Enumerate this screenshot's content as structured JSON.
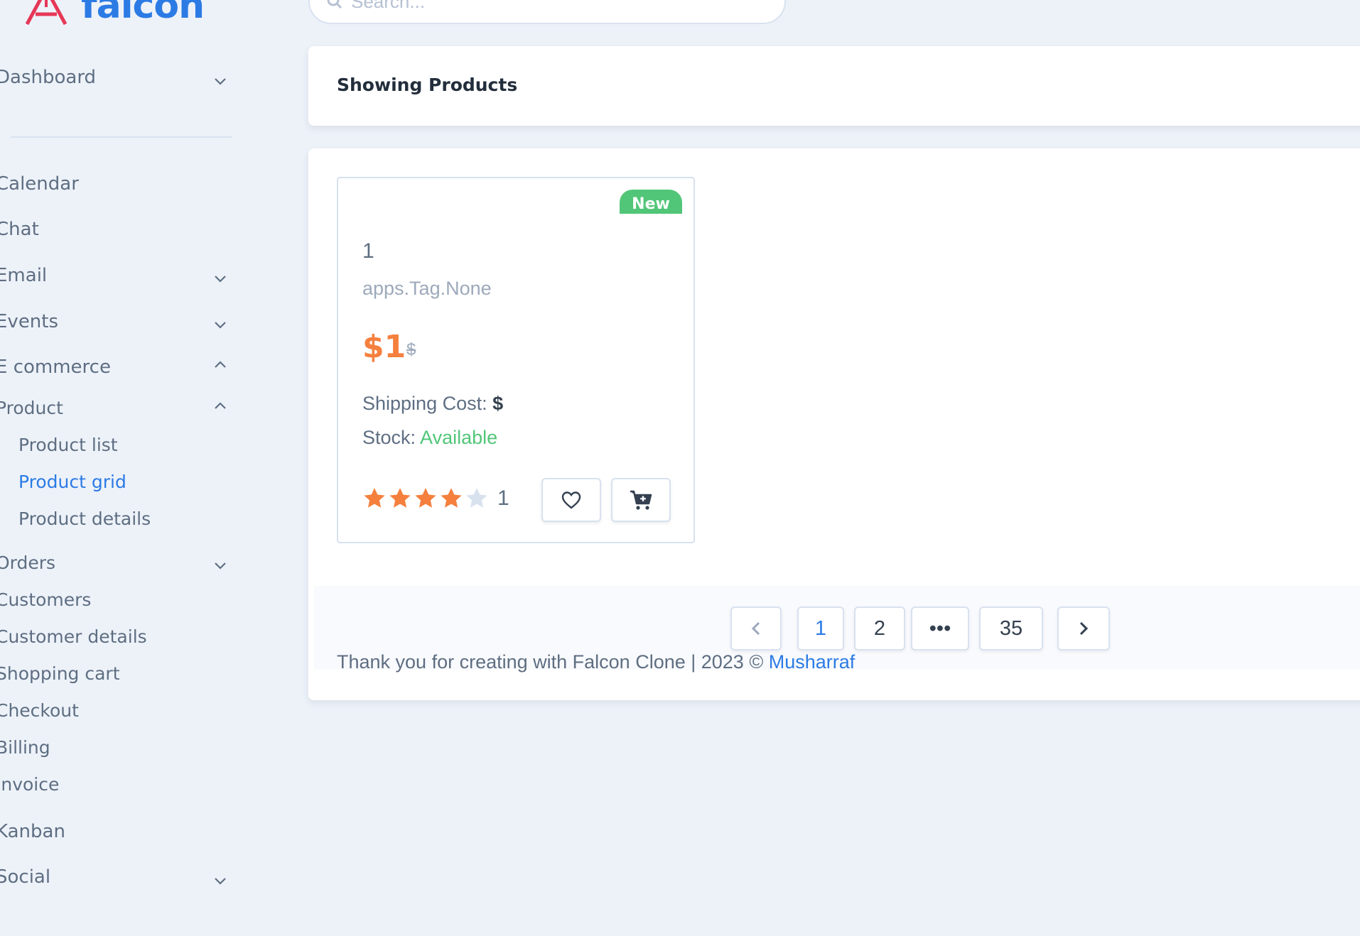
{
  "brand": {
    "name": "falcon"
  },
  "search": {
    "placeholder": "Search..."
  },
  "sidebar": {
    "dashboard": "Dashboard",
    "calendar": "Calendar",
    "chat": "Chat",
    "email": "Email",
    "events": "Events",
    "ecommerce": "E commerce",
    "product": "Product",
    "product_list": "Product list",
    "product_grid": "Product grid",
    "product_details": "Product details",
    "orders": "Orders",
    "customers": "Customers",
    "customer_details": "Customer details",
    "shopping_cart": "Shopping cart",
    "checkout": "Checkout",
    "billing": "Billing",
    "invoice": "Invoice",
    "kanban": "Kanban",
    "social": "Social"
  },
  "header": {
    "title": "Showing Products"
  },
  "product": {
    "badge": "New",
    "name": "1",
    "tag": "apps.Tag.None",
    "price": "$1",
    "old_price": "$",
    "shipping_label": "Shipping Cost:",
    "shipping_value": "$",
    "stock_label": "Stock:",
    "stock_value": "Available",
    "rating": 4,
    "rating_max": 5,
    "rating_count": "1"
  },
  "pagination": {
    "pages": [
      "1",
      "2",
      "•••",
      "35"
    ],
    "current": "1"
  },
  "footer": {
    "text": "Thank you for creating with Falcon Clone | 2023 ©",
    "author": "Musharraf"
  },
  "colors": {
    "accent": "#2c7be5",
    "price": "#f5803e",
    "success": "#52c678",
    "star_empty": "#d8e2ef"
  }
}
